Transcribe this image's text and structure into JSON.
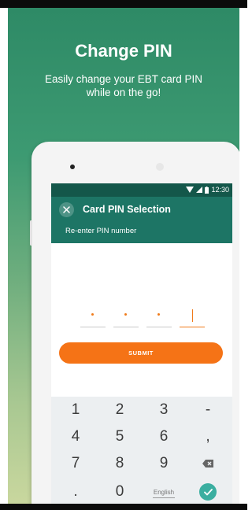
{
  "promo": {
    "title": "Change PIN",
    "subtitle": "Easily change your EBT card PIN while on the go!"
  },
  "status_bar": {
    "time": "12:30"
  },
  "app_bar": {
    "title": "Card PIN Selection",
    "subtitle": "Re-enter PIN number"
  },
  "pin_entry": {
    "entered_digits": 3,
    "total_digits": 4
  },
  "submit_label": "SUBMIT",
  "keypad": {
    "row1": [
      "1",
      "2",
      "3",
      "-"
    ],
    "row2": [
      "4",
      "5",
      "6",
      ","
    ],
    "row3": [
      "7",
      "8",
      "9"
    ],
    "row4": [
      ".",
      "0",
      "English"
    ]
  },
  "colors": {
    "app_bar": "#1d7565",
    "status_bar": "#14574a",
    "accent": "#f57316",
    "done_key": "#3aaea0"
  },
  "icons": [
    "close-icon",
    "wifi-icon",
    "signal-icon",
    "battery-icon",
    "backspace-icon",
    "check-icon"
  ]
}
